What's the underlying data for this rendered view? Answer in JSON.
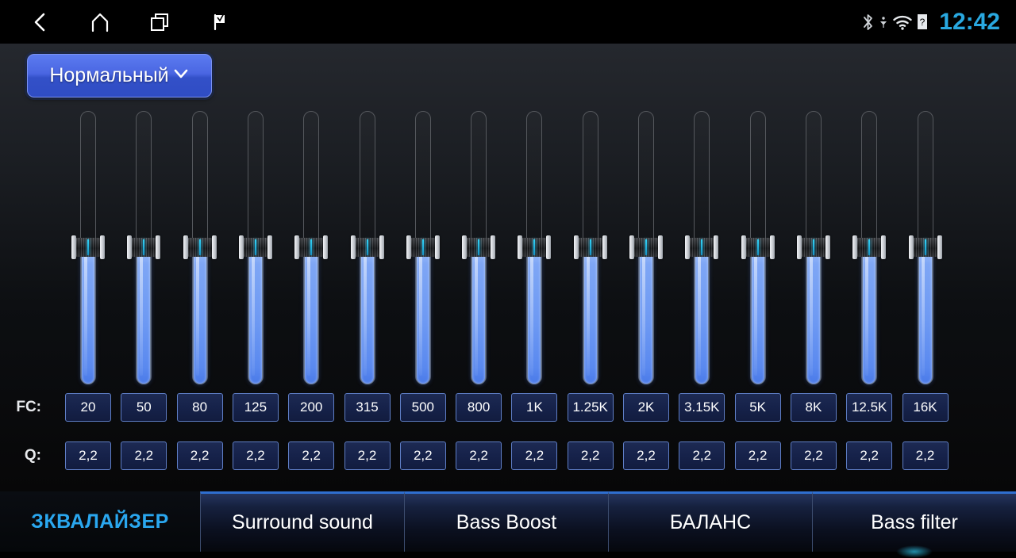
{
  "statusbar": {
    "nav": [
      {
        "name": "back-icon",
        "label": "Back"
      },
      {
        "name": "home-icon",
        "label": "Home"
      },
      {
        "name": "recents-icon",
        "label": "Recents"
      },
      {
        "name": "flag-icon",
        "label": "Flag"
      }
    ],
    "icons": [
      {
        "name": "bluetooth-icon",
        "label": "Bluetooth"
      },
      {
        "name": "signal-icon",
        "label": "Signal"
      },
      {
        "name": "wifi-icon",
        "label": "Wi-Fi"
      },
      {
        "name": "sim-unknown-icon",
        "label": "SIM unknown"
      }
    ],
    "clock": "12:42"
  },
  "preset": {
    "label": "Нормальный",
    "chevron": "⌄",
    "accent": "#4a66e2"
  },
  "equalizer": {
    "fc_label": "FC:",
    "q_label": "Q:",
    "bands": [
      {
        "fc": "20",
        "q": "2,2"
      },
      {
        "fc": "50",
        "q": "2,2"
      },
      {
        "fc": "80",
        "q": "2,2"
      },
      {
        "fc": "125",
        "q": "2,2"
      },
      {
        "fc": "200",
        "q": "2,2"
      },
      {
        "fc": "315",
        "q": "2,2"
      },
      {
        "fc": "500",
        "q": "2,2"
      },
      {
        "fc": "800",
        "q": "2,2"
      },
      {
        "fc": "1K",
        "q": "2,2"
      },
      {
        "fc": "1.25K",
        "q": "2,2"
      },
      {
        "fc": "2K",
        "q": "2,2"
      },
      {
        "fc": "3.15K",
        "q": "2,2"
      },
      {
        "fc": "5K",
        "q": "2,2"
      },
      {
        "fc": "8K",
        "q": "2,2"
      },
      {
        "fc": "12.5K",
        "q": "2,2"
      },
      {
        "fc": "16K",
        "q": "2,2"
      }
    ],
    "slider_level_percent": [
      50,
      50,
      50,
      50,
      50,
      50,
      50,
      50,
      50,
      50,
      50,
      50,
      50,
      50,
      50,
      50
    ],
    "fill_color": "#6d99f3"
  },
  "tabs": [
    {
      "label": "ЗКВАЛАЙЗЕР",
      "active": true
    },
    {
      "label": "Surround sound",
      "active": false
    },
    {
      "label": "Bass Boost",
      "active": false
    },
    {
      "label": "БАЛАНС",
      "active": false
    },
    {
      "label": "Bass filter",
      "active": false
    }
  ]
}
